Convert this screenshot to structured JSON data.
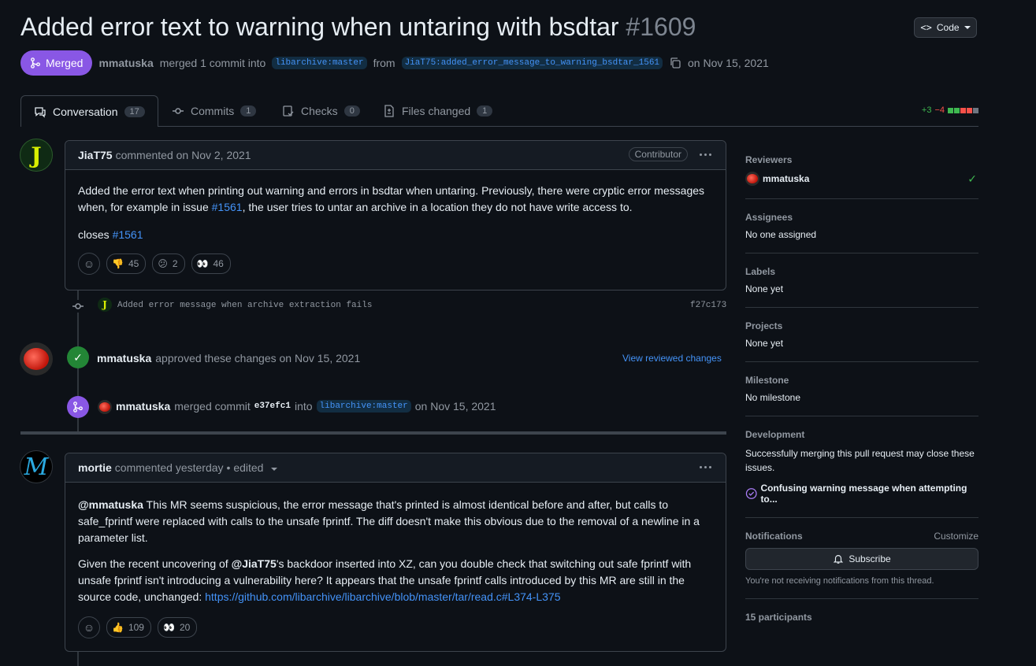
{
  "header": {
    "title": "Added error text to warning when untaring with bsdtar",
    "number": "#1609",
    "code_button": "Code"
  },
  "meta": {
    "state": "Merged",
    "author": "mmatuska",
    "action": "merged 1 commit into",
    "base_branch": "libarchive:master",
    "from_word": "from",
    "head_branch": "JiaT75:added_error_message_to_warning_bsdtar_1561",
    "date": "on Nov 15, 2021"
  },
  "tabs": [
    {
      "label": "Conversation",
      "count": "17"
    },
    {
      "label": "Commits",
      "count": "1"
    },
    {
      "label": "Checks",
      "count": "0"
    },
    {
      "label": "Files changed",
      "count": "1"
    }
  ],
  "diffstat": {
    "additions": "+3",
    "deletions": "−4"
  },
  "comment1": {
    "author": "JiaT75",
    "action": "commented on Nov 2, 2021",
    "role": "Contributor",
    "body_part1": "Added the error text when printing out warning and errors in bsdtar when untaring. Previously, there were cryptic error messages when, for example in issue ",
    "issue_link": "#1561",
    "body_part2": ", the user tries to untar an archive in a location they do not have write access to.",
    "closes_word": "closes",
    "closes_link": "#1561",
    "reactions": [
      {
        "emoji": "👎",
        "count": "45"
      },
      {
        "emoji": "😕",
        "count": "2"
      },
      {
        "emoji": "👀",
        "count": "46"
      }
    ]
  },
  "commit": {
    "message": "Added error message when archive extraction fails",
    "sha": "f27c173"
  },
  "approval": {
    "author": "mmatuska",
    "text": "approved these changes on Nov 15, 2021",
    "link": "View reviewed changes"
  },
  "merge_event": {
    "author": "mmatuska",
    "text": "merged commit",
    "sha": "e37efc1",
    "into": "into",
    "branch": "libarchive:master",
    "date": "on Nov 15, 2021"
  },
  "comment2": {
    "author": "mortie",
    "action": "commented yesterday",
    "edited": "• edited",
    "mention1": "@mmatuska",
    "p1": " This MR seems suspicious, the error message that's printed is almost identical before and after, but calls to safe_fprintf were replaced with calls to the unsafe fprintf. The diff doesn't make this obvious due to the removal of a newline in a parameter list.",
    "p2_a": "Given the recent uncovering of ",
    "mention2": "@JiaT75",
    "p2_b": "'s backdoor inserted into XZ, can you double check that switching out safe fprintf with unsafe fprintf isn't introducing a vulnerability here? It appears that the unsafe fprintf calls introduced by this MR are still in the source code, unchanged: ",
    "link": "https://github.com/libarchive/libarchive/blob/master/tar/read.c#L374-L375",
    "reactions": [
      {
        "emoji": "👍",
        "count": "109"
      },
      {
        "emoji": "👀",
        "count": "20"
      }
    ]
  },
  "sidebar": {
    "reviewers_h": "Reviewers",
    "reviewer": "mmatuska",
    "assignees_h": "Assignees",
    "assignees_v": "No one assigned",
    "labels_h": "Labels",
    "labels_v": "None yet",
    "projects_h": "Projects",
    "projects_v": "None yet",
    "milestone_h": "Milestone",
    "milestone_v": "No milestone",
    "development_h": "Development",
    "development_v": "Successfully merging this pull request may close these issues.",
    "linked_issue": "Confusing warning message when attempting to...",
    "notifications_h": "Notifications",
    "customize": "Customize",
    "subscribe": "Subscribe",
    "notif_note": "You're not receiving notifications from this thread.",
    "participants": "15 participants"
  },
  "colors": {
    "merged": "#8957e5",
    "approve": "#238636",
    "link": "#4493f8"
  }
}
